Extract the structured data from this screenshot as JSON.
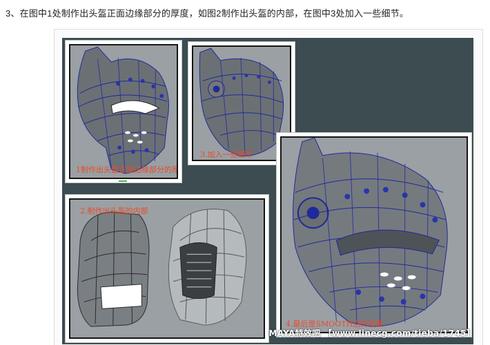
{
  "caption": "3、在图中1处制作出头盔正面边缘部分的厚度，如图2制作出头盔的内部，在图中3处加入一些细节。",
  "panels": [
    {
      "id": 1,
      "label": "1制作出头盔正面边缘部分的厚度"
    },
    {
      "id": 3,
      "label": "3.加入一些细节"
    },
    {
      "id": 2,
      "label": "2.制作出头盔的内部"
    },
    {
      "id": 4,
      "label": "4.最后是SMOOTH后的效果"
    }
  ],
  "watermark": "MAYA特效吧  【www.linecg.com/tieba/1745】",
  "colors": {
    "background": "#3c4c50",
    "label": "#e84a2e",
    "wire": "#1e2a9a"
  }
}
